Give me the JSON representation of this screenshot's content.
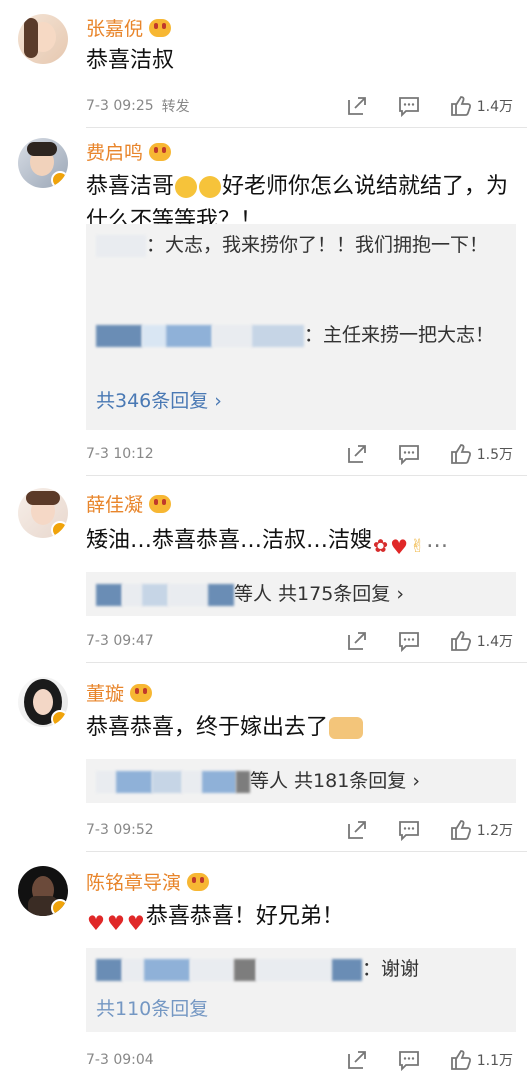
{
  "comments": [
    {
      "name": "张嘉倪",
      "text": "恭喜洁叔",
      "time": "7-3 09:25",
      "forward": "转发",
      "likes": "1.4万"
    },
    {
      "name": "费启鸣",
      "text_a": "恭喜洁哥",
      "text_b": "好老师你怎么说结就结了，为什么不等等我？！",
      "replies": [
        {
          "text": "：大志，我来捞你了！！我们拥抱一下！"
        },
        {
          "text": "：主任来捞一把大志！"
        }
      ],
      "more": "共346条回复 ›",
      "time": "7-3 10:12",
      "likes": "1.5万"
    },
    {
      "name": "薛佳凝",
      "text": "矮油…恭喜恭喜…洁叔…洁嫂",
      "reply_text": "等人 共175条回复 ›",
      "time": "7-3 09:47",
      "likes": "1.4万"
    },
    {
      "name": "董璇",
      "text": "恭喜恭喜，终于嫁出去了",
      "reply_text": "等人 共181条回复 ›",
      "time": "7-3 09:52",
      "likes": "1.2万"
    },
    {
      "name": "陈铭章导演",
      "text": "恭喜恭喜！好兄弟！",
      "reply_text": "：谢谢",
      "more": "共110条回复",
      "time": "7-3 09:04",
      "likes": "1.1万"
    }
  ],
  "colors": {
    "name": "#e8852b",
    "link": "#4a79b4",
    "reply_bg": "#f2f2f2"
  }
}
